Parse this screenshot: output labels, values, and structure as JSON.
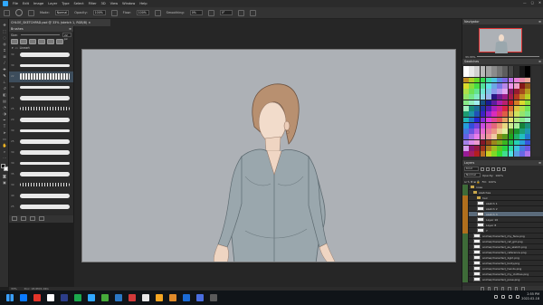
{
  "menu": [
    "File",
    "Edit",
    "Image",
    "Layer",
    "Type",
    "Select",
    "Filter",
    "3D",
    "View",
    "Window",
    "Help"
  ],
  "options": {
    "mode_label": "Mode:",
    "mode_value": "Normal",
    "opacity_label": "Opacity:",
    "opacity_value": "100%",
    "flow_label": "Flow:",
    "flow_value": "100%",
    "smoothing_label": "Smoothing:",
    "smoothing_value": "0%",
    "angle_value": "0°"
  },
  "document": {
    "tab_title": "CHLOE_SKETCHPAD.psd @ 33% (sketch 1, RGB/8)"
  },
  "brushes_panel": {
    "title": "Brushes",
    "size_label": "Size:",
    "size_value": "22 px",
    "folder_name": "Lineart",
    "strokes": [
      {
        "num": "30"
      },
      {
        "num": "30"
      },
      {
        "num": "22"
      },
      {
        "num": "30"
      },
      {
        "num": "25"
      },
      {
        "num": "25"
      },
      {
        "num": "20"
      },
      {
        "num": "30"
      },
      {
        "num": "25"
      },
      {
        "num": "30"
      },
      {
        "num": "30"
      },
      {
        "num": "35"
      },
      {
        "num": "30"
      },
      {
        "num": "40"
      },
      {
        "num": "25"
      }
    ]
  },
  "navigator": {
    "title": "Navigator",
    "zoom": "33.33%"
  },
  "swatches": {
    "title": "Swatches"
  },
  "layers_panel": {
    "title": "Layers",
    "kind": "Kind",
    "blend": "Normal",
    "opacity_label": "Opacity:",
    "opacity": "100%",
    "fill_label": "Fill:",
    "fill": "100%",
    "items": [
      {
        "name": "nose",
        "type": "folder",
        "indent": 0,
        "eye": "g"
      },
      {
        "name": "sketches",
        "type": "folder",
        "indent": 1,
        "eye": "g"
      },
      {
        "name": "hair",
        "type": "folder",
        "indent": 2,
        "eye": "o"
      },
      {
        "name": "sketch 1",
        "type": "layer",
        "indent": 2,
        "eye": "o"
      },
      {
        "name": "sketch 2",
        "type": "layer",
        "indent": 2,
        "eye": "o"
      },
      {
        "name": "sketch 3",
        "type": "layer",
        "indent": 2,
        "eye": "o",
        "selected": true
      },
      {
        "name": "Layer 10",
        "type": "layer",
        "indent": 2,
        "eye": "o"
      },
      {
        "name": "Layer 8",
        "type": "layer",
        "indent": 2,
        "eye": "o"
      },
      {
        "name": "Y",
        "type": "layer",
        "indent": 2,
        "eye": "o"
      },
      {
        "name": "anime(character)_my_face.png",
        "type": "layer",
        "indent": 1,
        "eye": "g"
      },
      {
        "name": "anime(character)_ref_girl.png",
        "type": "layer",
        "indent": 1,
        "eye": "g"
      },
      {
        "name": "anime(character)_as_sketch.png",
        "type": "layer",
        "indent": 1,
        "eye": "g"
      },
      {
        "name": "anime(character)_reference.png",
        "type": "layer",
        "indent": 1,
        "eye": "g"
      },
      {
        "name": "anime(character)_1girl.png",
        "type": "layer",
        "indent": 1,
        "eye": "g"
      },
      {
        "name": "anime(character)_body.png",
        "type": "layer",
        "indent": 1,
        "eye": "g"
      },
      {
        "name": "anime(character)_hands.png",
        "type": "layer",
        "indent": 1,
        "eye": "g"
      },
      {
        "name": "anime(character)_my_clothes.png",
        "type": "layer",
        "indent": 1,
        "eye": "g"
      },
      {
        "name": "anime(character)_pose.png",
        "type": "layer",
        "indent": 1,
        "eye": "g"
      }
    ]
  },
  "status": {
    "zoom": "33%",
    "doc": "Doc: 18.6M/1.02G"
  },
  "taskbar": {
    "time": "2:55 PM",
    "date": "2022-02-18",
    "icons": [
      "#0a7aff",
      "#e3352a",
      "#ffffff",
      "#2c3e8a",
      "#1ba94c",
      "#31a8ff",
      "#46aa3a",
      "#2b78c5",
      "#d23a3a",
      "#e8e8e8",
      "#f5a623",
      "#e08a2a",
      "#1b6bd6",
      "#4a6ee0",
      "#5a5a5a"
    ]
  }
}
